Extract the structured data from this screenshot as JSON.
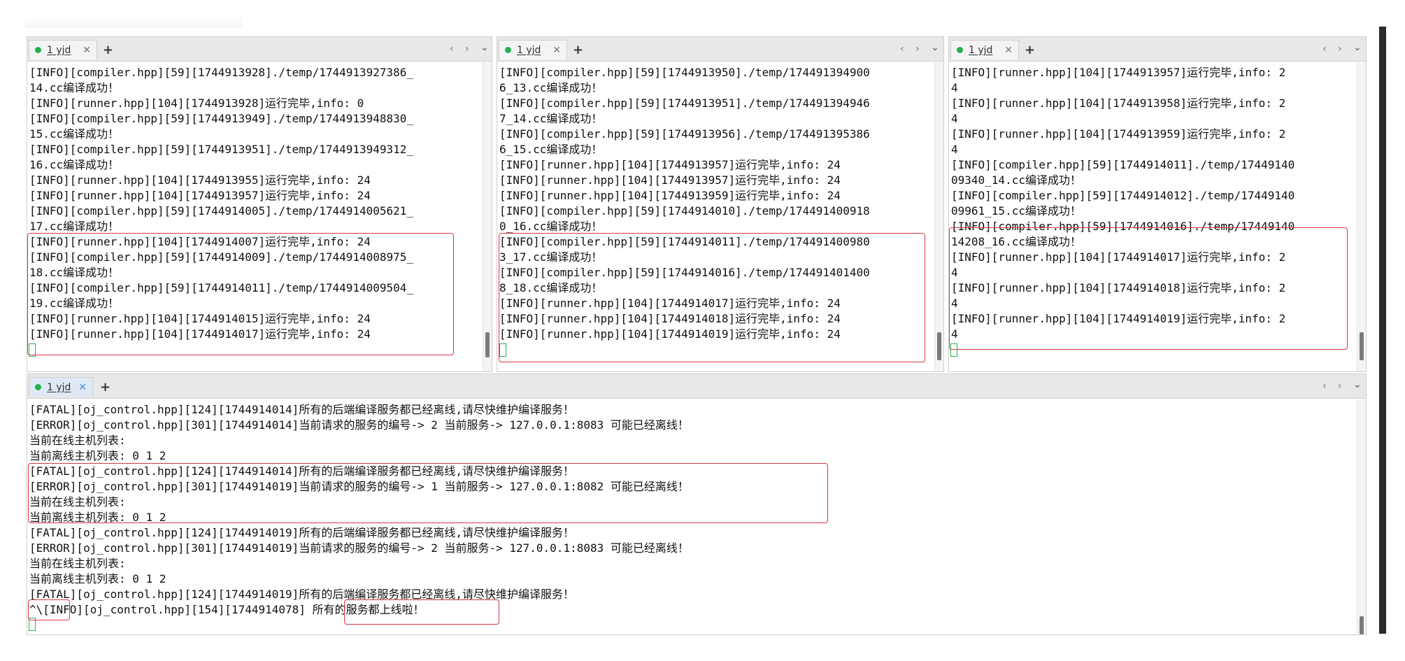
{
  "colors": {
    "highlight": "#d9364a",
    "tab_dot": "#23b14d",
    "cursor": "#29b34b",
    "active_tab": "#dfe9f6"
  },
  "panes": {
    "p1": {
      "tab_label": "1 yjd",
      "lines": [
        "[INFO][compiler.hpp][59][1744913928]./temp/1744913927386_",
        "14.cc编译成功！",
        "[INFO][runner.hpp][104][1744913928]运行完毕,info: 0",
        "[INFO][compiler.hpp][59][1744913949]./temp/1744913948830_",
        "15.cc编译成功！",
        "[INFO][compiler.hpp][59][1744913951]./temp/1744913949312_",
        "16.cc编译成功！",
        "[INFO][runner.hpp][104][1744913955]运行完毕,info: 24",
        "[INFO][runner.hpp][104][1744913957]运行完毕,info: 24",
        "[INFO][compiler.hpp][59][1744914005]./temp/1744914005621_",
        "17.cc编译成功！",
        "[INFO][runner.hpp][104][1744914007]运行完毕,info: 24",
        "[INFO][compiler.hpp][59][1744914009]./temp/1744914008975_",
        "18.cc编译成功！",
        "[INFO][compiler.hpp][59][1744914011]./temp/1744914009504_",
        "19.cc编译成功！",
        "[INFO][runner.hpp][104][1744914015]运行完毕,info: 24",
        "[INFO][runner.hpp][104][1744914017]运行完毕,info: 24"
      ]
    },
    "p2": {
      "tab_label": "1 yjd",
      "lines": [
        "[INFO][compiler.hpp][59][1744913950]./temp/174491394900",
        "6_13.cc编译成功！",
        "[INFO][compiler.hpp][59][1744913951]./temp/174491394946",
        "7_14.cc编译成功！",
        "[INFO][compiler.hpp][59][1744913956]./temp/174491395386",
        "6_15.cc编译成功！",
        "[INFO][runner.hpp][104][1744913957]运行完毕,info: 24",
        "[INFO][runner.hpp][104][1744913957]运行完毕,info: 24",
        "[INFO][runner.hpp][104][1744913959]运行完毕,info: 24",
        "[INFO][compiler.hpp][59][1744914010]./temp/174491400918",
        "0_16.cc编译成功！",
        "[INFO][compiler.hpp][59][1744914011]./temp/174491400980",
        "3_17.cc编译成功！",
        "[INFO][compiler.hpp][59][1744914016]./temp/174491401400",
        "8_18.cc编译成功！",
        "[INFO][runner.hpp][104][1744914017]运行完毕,info: 24",
        "[INFO][runner.hpp][104][1744914018]运行完毕,info: 24",
        "[INFO][runner.hpp][104][1744914019]运行完毕,info: 24"
      ]
    },
    "p3": {
      "tab_label": "1 yjd",
      "lines": [
        "[INFO][runner.hpp][104][1744913957]运行完毕,info: 2",
        "4",
        "[INFO][runner.hpp][104][1744913958]运行完毕,info: 2",
        "4",
        "[INFO][runner.hpp][104][1744913959]运行完毕,info: 2",
        "4",
        "[INFO][compiler.hpp][59][1744914011]./temp/17449140",
        "09340_14.cc编译成功！",
        "[INFO][compiler.hpp][59][1744914012]./temp/17449140",
        "09961_15.cc编译成功！",
        "[INFO][compiler.hpp][59][1744914016]./temp/17449140",
        "14208_16.cc编译成功！",
        "[INFO][runner.hpp][104][1744914017]运行完毕,info: 2",
        "4",
        "[INFO][runner.hpp][104][1744914018]运行完毕,info: 2",
        "4",
        "[INFO][runner.hpp][104][1744914019]运行完毕,info: 2",
        "4"
      ]
    },
    "bottom": {
      "tab_label": "1 yjd",
      "lines": [
        "[FATAL][oj_control.hpp][124][1744914014]所有的后端编译服务都已经离线,请尽快维护编译服务！",
        "[ERROR][oj_control.hpp][301][1744914014]当前请求的服务的编号-> 2 当前服务-> 127.0.0.1:8083 可能已经离线！",
        "当前在线主机列表:",
        "当前离线主机列表: 0 1 2",
        "[FATAL][oj_control.hpp][124][1744914014]所有的后端编译服务都已经离线,请尽快维护编译服务！",
        "[ERROR][oj_control.hpp][301][1744914019]当前请求的服务的编号-> 1 当前服务-> 127.0.0.1:8082 可能已经离线！",
        "当前在线主机列表:",
        "当前离线主机列表: 0 1 2",
        "[FATAL][oj_control.hpp][124][1744914019]所有的后端编译服务都已经离线,请尽快维护编译服务！",
        "[ERROR][oj_control.hpp][301][1744914019]当前请求的服务的编号-> 2 当前服务-> 127.0.0.1:8083 可能已经离线！",
        "当前在线主机列表:",
        "当前离线主机列表: 0 1 2",
        "[FATAL][oj_control.hpp][124][1744914019]所有的后端编译服务都已经离线,请尽快维护编译服务！",
        "^\\[INFO][oj_control.hpp][154][1744914078] 所有的服务都上线啦！"
      ]
    }
  },
  "icons": {
    "close": "✕",
    "add": "+",
    "nav": "‹ ›",
    "dropdown": "⌄"
  }
}
